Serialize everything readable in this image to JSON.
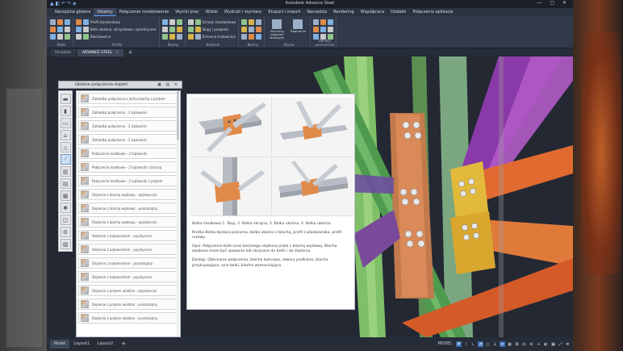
{
  "window": {
    "title": "Autodesk Advance Steel"
  },
  "menubar": {
    "items": [
      {
        "label": "Narzędzia główne",
        "active": false
      },
      {
        "label": "Obiekty",
        "active": true
      },
      {
        "label": "Połączenie modelowanie",
        "active": false
      },
      {
        "label": "Wyniki prac",
        "active": false
      },
      {
        "label": "Widok",
        "active": false
      },
      {
        "label": "Wydruki i wymiary",
        "active": false
      },
      {
        "label": "Eksport i import",
        "active": false
      },
      {
        "label": "Narzędzia",
        "active": false
      },
      {
        "label": "Rendering",
        "active": false
      },
      {
        "label": "Współpraca",
        "active": false
      },
      {
        "label": "Dodatki",
        "active": false
      },
      {
        "label": "Połączenia aplikacje",
        "active": false
      }
    ]
  },
  "ribbon": {
    "groups": [
      {
        "label": "Siatki",
        "rows": [
          "",
          "",
          ""
        ]
      },
      {
        "label": "Profile",
        "rows": [
          "Profil standardowy",
          "Belki złożone, skrzynkowe i symetryczne",
          "Blachownica"
        ]
      },
      {
        "label": "Blachy",
        "rows": [
          "",
          "",
          ""
        ]
      },
      {
        "label": "Budynki",
        "rows": [
          "Schody standardowe",
          "Słupy i podporki",
          "Zmienna kratownica"
        ]
      },
      {
        "label": "Blachy",
        "rows": [
          "",
          "",
          ""
        ]
      },
      {
        "label": "Złącze",
        "big": [
          "Elementy połączeń złożonych",
          "Połączenia"
        ]
      },
      {
        "label": "Obiekty pomocnicze",
        "rows": [
          "",
          "",
          ""
        ]
      }
    ]
  },
  "doctabs": {
    "items": [
      {
        "label": "Początek",
        "active": false
      },
      {
        "label": "ADVANCE STEEL",
        "active": true
      }
    ]
  },
  "palette": {
    "title": "Główne połączenia stężeń",
    "items": [
      "Zakładka połączenia z jedną blachą z prętem",
      "Zakładka połączenia - 2 kątowniki",
      "Zakładka połączenia - 2 kątowniki",
      "Zakładka połączenia - 2 kątowniki",
      "Połączenie środkowe - 2 kątowniki",
      "Połączenie środkowe - 2 kątowniki z blachą",
      "Połączenie środkowe - 2 kątowniki z prętem",
      "Stężenie z blachą węzłową - pojedyncze",
      "Stężenie z blachą węzłową - prostokątny",
      "Stężenie z blachą węzłową - pojedyncze",
      "Stężenie z kątownikiem - pojedyncze",
      "Stężenie z kątownikiem - pojedyncze",
      "Stężenie z kątownikiem - prostokątny",
      "Stężenie z kątownikiem - pojedyncze",
      "Stężenie z prętem wiotkim - pojedyncze",
      "Stężenie z prętem wiotkim - prostokątny",
      "Stężenie z prętem wiotkim - prostokątny"
    ]
  },
  "tooltip": {
    "paragraphs": [
      "Belka środkowa 1. Słup, 2. Belka skrajna, 3. Belka ukośna, 4. Belka ukośna.",
      "Kratka Belka łącząca pozioma, belka ukośna z blachą, profil z płaskownika, profil rurowy.",
      "Opis: Połączenie belki oraz bocznego stężenia pręta z blachą węzłową. Blacha węzłowa może być spawana lub skręcana do belki i do stężenia.",
      "Dostęp: Obliczanie połączenia, blacha końcowa, otwory podłużne, blacha przykrywająca, osie belki, blacha wzmacniająca."
    ]
  },
  "statusbar": {
    "tabs": [
      {
        "label": "Model",
        "active": true
      },
      {
        "label": "Layout1",
        "active": false
      },
      {
        "label": "Layout2",
        "active": false
      }
    ],
    "space": "MODEL"
  },
  "colors": {
    "accent": "#5aa0ff",
    "green_beam": "#7fbf68",
    "orange_plate": "#e07a3a",
    "purple_brace": "#7a5ab0",
    "yellow_plate": "#e2b93b"
  }
}
